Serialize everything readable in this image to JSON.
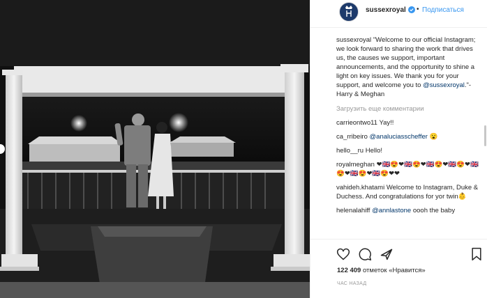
{
  "header": {
    "username": "sussexroyal",
    "verified_icon": "verified-badge-icon",
    "separator": "•",
    "follow_label": "Подписаться"
  },
  "caption": {
    "username": "sussexroyal",
    "text": "\"Welcome to our official Instagram; we look forward to sharing the work that drives us, the causes we support, important announcements, and the opportunity to shine a light on key issues. We thank you for your support, and welcome you to ",
    "mention": "@sussexroyal",
    "text_end": ".\"- Harry & Meghan"
  },
  "load_more": "Загрузить еще комментарии",
  "comments": [
    {
      "username": "carrieontwo11",
      "text": "Yay!!"
    },
    {
      "username": "ca_rribeiro",
      "mention": "@analuciasscheffer",
      "text": "😮"
    },
    {
      "username": "hello__ru",
      "text": "Hello!"
    },
    {
      "username": "royalmeghan",
      "text": "❤🇬🇧😍❤🇬🇧😍❤🇬🇧😍❤🇬🇧😍❤🇬🇧😍❤🇬🇧😍❤🇬🇧😍❤❤"
    },
    {
      "username": "vahideh.khatami",
      "text": "Welcome to Instagram, Duke & Duchess. And congratulations for yor twin👶"
    },
    {
      "username": "helenalahiff",
      "mention": "@annlastone",
      "text": "oooh the baby"
    }
  ],
  "actions": {
    "like_icon": "heart-icon",
    "comment_icon": "comment-icon",
    "share_icon": "share-icon",
    "save_icon": "bookmark-icon"
  },
  "likes": {
    "count": "122 409",
    "label": " отметок «Нравится»"
  },
  "time": "ЧАС НАЗАД",
  "colors": {
    "link": "#3897f0",
    "mention": "#003569",
    "muted": "#999999"
  }
}
